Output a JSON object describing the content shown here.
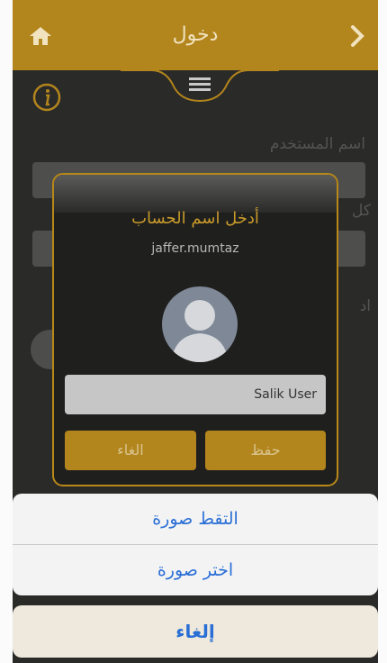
{
  "header": {
    "title": "دخول"
  },
  "background_form": {
    "username_label": "اسم المستخدم",
    "password_label_fragment": "كل",
    "hint_fragment": "اد"
  },
  "dialog": {
    "title": "أدخل اسم الحساب",
    "username": "jaffer.mumtaz",
    "name_value": "Salik User",
    "cancel_label": "الغاء",
    "save_label": "حفظ"
  },
  "action_sheet": {
    "take_photo": "التقط صورة",
    "choose_photo": "اختر صورة",
    "cancel": "إلغاء"
  },
  "colors": {
    "accent_gold": "#b3851d",
    "background_dark": "#2a2a28",
    "link_blue": "#2a6fd6"
  },
  "icons": {
    "home": "home-icon",
    "back": "chevron-right-icon",
    "menu": "hamburger-menu-icon",
    "info": "info-icon",
    "avatar": "user-silhouette-icon"
  }
}
